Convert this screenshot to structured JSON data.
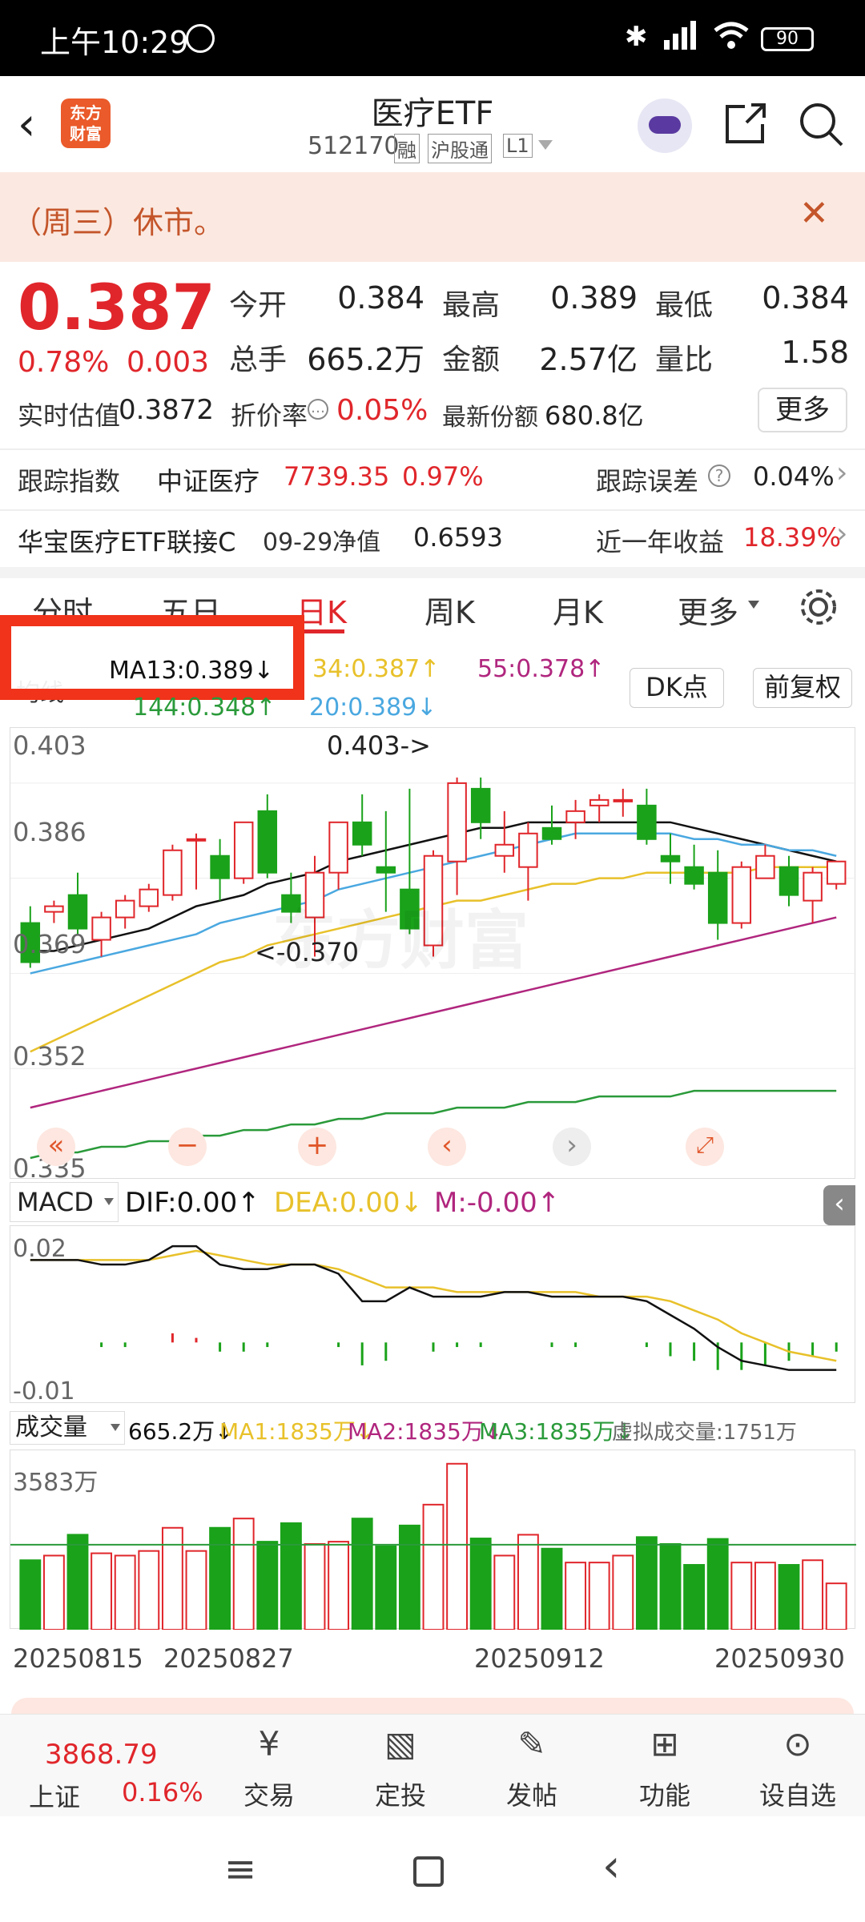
{
  "status": {
    "time": "上午10:29",
    "battery": "90"
  },
  "header": {
    "app_logo": "东方\n财富",
    "title": "医疗ETF",
    "code": "512170",
    "tag1": "融",
    "tag2": "沪股通",
    "tag3": "L1"
  },
  "notice": {
    "text": "（周三）休市。"
  },
  "quote": {
    "price": "0.387",
    "pct": "0.78%",
    "chg": "0.003",
    "open_label": "今开",
    "open": "0.384",
    "high_label": "最高",
    "high": "0.389",
    "low_label": "最低",
    "low": "0.384",
    "vol_label": "总手",
    "vol": "665.2万",
    "amt_label": "金额",
    "amt": "2.57亿",
    "ratio_label": "量比",
    "ratio": "1.58",
    "est_label": "实时估值",
    "est": "0.3872",
    "disc_label": "折价率",
    "disc": "0.05%",
    "share_label": "最新份额",
    "share": "680.8亿",
    "more": "更多"
  },
  "tracking": {
    "label": "跟踪指数",
    "name": "中证医疗",
    "value": "7739.35",
    "pct": "0.97%",
    "err_label": "跟踪误差",
    "err": "0.04%"
  },
  "fund": {
    "name": "华宝医疗ETF联接C",
    "date": "09-29净值",
    "nav": "0.6593",
    "ret_label": "近一年收益",
    "ret": "18.39%"
  },
  "tabs": [
    "分时",
    "五日",
    "日K",
    "周K",
    "月K",
    "更多"
  ],
  "ma_legend": {
    "type": "均线",
    "ma13": "MA13:0.389↓",
    "ma34": "34:0.387↑",
    "ma55": "55:0.378↑",
    "ma144": "144:0.348↑",
    "ma20": "20:0.389↓",
    "dk": "DK点",
    "fq": "前复权"
  },
  "kline_labels": {
    "y1": "0.403",
    "y2": "0.386",
    "y3": "0.369",
    "y4": "0.352",
    "y5": "0.335",
    "hi": "0.403->",
    "lo": "<-0.370",
    "watermark": "东方财富"
  },
  "macd": {
    "name": "MACD",
    "dif": "DIF:0.00↑",
    "dea": "DEA:0.00↓",
    "m": "M:-0.00↑",
    "ytop": "0.02",
    "ybot": "-0.01"
  },
  "volume": {
    "name": "成交量",
    "vol": "665.2万↓",
    "ma1": "MA1:1835万↓",
    "ma2": "MA2:1835万↓",
    "ma3": "MA3:1835万↓",
    "virtual": "虚拟成交量:1751万",
    "ytop": "3583万"
  },
  "xdates": [
    "20250815",
    "20250827",
    "20250912",
    "20250930"
  ],
  "bottom": {
    "index_val": "3868.79",
    "index_name": "上证",
    "index_pct": "0.16%",
    "items": [
      "交易",
      "定投",
      "发帖",
      "功能",
      "设自选"
    ]
  },
  "chart_data": {
    "type": "candlestick",
    "ylim": [
      0.335,
      0.41
    ],
    "candles": [
      {
        "o": 0.378,
        "h": 0.381,
        "l": 0.37,
        "c": 0.371
      },
      {
        "o": 0.38,
        "h": 0.382,
        "l": 0.378,
        "c": 0.381
      },
      {
        "o": 0.383,
        "h": 0.387,
        "l": 0.376,
        "c": 0.377
      },
      {
        "o": 0.375,
        "h": 0.38,
        "l": 0.372,
        "c": 0.379
      },
      {
        "o": 0.379,
        "h": 0.383,
        "l": 0.377,
        "c": 0.382
      },
      {
        "o": 0.381,
        "h": 0.385,
        "l": 0.38,
        "c": 0.384
      },
      {
        "o": 0.383,
        "h": 0.392,
        "l": 0.382,
        "c": 0.391
      },
      {
        "o": 0.393,
        "h": 0.394,
        "l": 0.384,
        "c": 0.393
      },
      {
        "o": 0.39,
        "h": 0.393,
        "l": 0.382,
        "c": 0.386
      },
      {
        "o": 0.386,
        "h": 0.396,
        "l": 0.385,
        "c": 0.396
      },
      {
        "o": 0.398,
        "h": 0.401,
        "l": 0.386,
        "c": 0.387
      },
      {
        "o": 0.383,
        "h": 0.387,
        "l": 0.378,
        "c": 0.38
      },
      {
        "o": 0.379,
        "h": 0.39,
        "l": 0.372,
        "c": 0.387
      },
      {
        "o": 0.387,
        "h": 0.396,
        "l": 0.384,
        "c": 0.396
      },
      {
        "o": 0.396,
        "h": 0.401,
        "l": 0.39,
        "c": 0.392
      },
      {
        "o": 0.388,
        "h": 0.398,
        "l": 0.38,
        "c": 0.387
      },
      {
        "o": 0.384,
        "h": 0.402,
        "l": 0.376,
        "c": 0.377
      },
      {
        "o": 0.374,
        "h": 0.391,
        "l": 0.372,
        "c": 0.39
      },
      {
        "o": 0.389,
        "h": 0.404,
        "l": 0.383,
        "c": 0.403
      },
      {
        "o": 0.402,
        "h": 0.404,
        "l": 0.393,
        "c": 0.396
      },
      {
        "o": 0.39,
        "h": 0.398,
        "l": 0.387,
        "c": 0.392
      },
      {
        "o": 0.388,
        "h": 0.396,
        "l": 0.382,
        "c": 0.394
      },
      {
        "o": 0.395,
        "h": 0.399,
        "l": 0.392,
        "c": 0.393
      },
      {
        "o": 0.396,
        "h": 0.4,
        "l": 0.393,
        "c": 0.398
      },
      {
        "o": 0.399,
        "h": 0.401,
        "l": 0.396,
        "c": 0.4
      },
      {
        "o": 0.4,
        "h": 0.402,
        "l": 0.397,
        "c": 0.4
      },
      {
        "o": 0.399,
        "h": 0.402,
        "l": 0.392,
        "c": 0.393
      },
      {
        "o": 0.39,
        "h": 0.394,
        "l": 0.385,
        "c": 0.389
      },
      {
        "o": 0.388,
        "h": 0.392,
        "l": 0.384,
        "c": 0.385
      },
      {
        "o": 0.387,
        "h": 0.391,
        "l": 0.375,
        "c": 0.378
      },
      {
        "o": 0.378,
        "h": 0.389,
        "l": 0.377,
        "c": 0.388
      },
      {
        "o": 0.386,
        "h": 0.392,
        "l": 0.386,
        "c": 0.39
      },
      {
        "o": 0.388,
        "h": 0.39,
        "l": 0.381,
        "c": 0.383
      },
      {
        "o": 0.382,
        "h": 0.388,
        "l": 0.378,
        "c": 0.387
      },
      {
        "o": 0.385,
        "h": 0.389,
        "l": 0.384,
        "c": 0.389
      }
    ],
    "ma_series": [
      {
        "color": "#111111",
        "values": [
          0.373,
          0.373,
          0.374,
          0.375,
          0.376,
          0.377,
          0.379,
          0.381,
          0.382,
          0.383,
          0.385,
          0.386,
          0.387,
          0.389,
          0.39,
          0.391,
          0.392,
          0.393,
          0.394,
          0.395,
          0.395,
          0.396,
          0.396,
          0.396,
          0.396,
          0.396,
          0.396,
          0.396,
          0.395,
          0.394,
          0.393,
          0.392,
          0.391,
          0.39,
          0.389
        ]
      },
      {
        "color": "#4aa8e0",
        "values": [
          0.369,
          0.37,
          0.371,
          0.372,
          0.373,
          0.374,
          0.375,
          0.376,
          0.378,
          0.379,
          0.38,
          0.381,
          0.382,
          0.384,
          0.385,
          0.386,
          0.387,
          0.388,
          0.389,
          0.39,
          0.391,
          0.392,
          0.393,
          0.394,
          0.394,
          0.394,
          0.394,
          0.394,
          0.393,
          0.393,
          0.392,
          0.392,
          0.391,
          0.391,
          0.39
        ]
      },
      {
        "color": "#e8c12a",
        "values": [
          0.355,
          0.357,
          0.359,
          0.361,
          0.363,
          0.365,
          0.367,
          0.369,
          0.371,
          0.372,
          0.374,
          0.375,
          0.376,
          0.377,
          0.378,
          0.379,
          0.38,
          0.381,
          0.382,
          0.382,
          0.383,
          0.384,
          0.385,
          0.385,
          0.386,
          0.386,
          0.387,
          0.387,
          0.387,
          0.387,
          0.387,
          0.388,
          0.388,
          0.388,
          0.388
        ]
      },
      {
        "color": "#b0267e",
        "values": [
          0.345,
          0.346,
          0.347,
          0.348,
          0.349,
          0.35,
          0.351,
          0.352,
          0.353,
          0.354,
          0.355,
          0.356,
          0.357,
          0.358,
          0.359,
          0.36,
          0.361,
          0.362,
          0.363,
          0.364,
          0.365,
          0.366,
          0.367,
          0.368,
          0.369,
          0.37,
          0.371,
          0.372,
          0.373,
          0.374,
          0.375,
          0.376,
          0.377,
          0.378,
          0.379
        ]
      },
      {
        "color": "#2a9a3a",
        "values": [
          0.336,
          0.337,
          0.337,
          0.338,
          0.338,
          0.339,
          0.339,
          0.34,
          0.34,
          0.341,
          0.341,
          0.342,
          0.342,
          0.343,
          0.343,
          0.344,
          0.344,
          0.344,
          0.345,
          0.345,
          0.345,
          0.346,
          0.346,
          0.346,
          0.347,
          0.347,
          0.347,
          0.347,
          0.348,
          0.348,
          0.348,
          0.348,
          0.348,
          0.348,
          0.348
        ]
      }
    ],
    "volumes": [
      1500,
      1600,
      2050,
      1650,
      1600,
      1700,
      2200,
      1700,
      2200,
      2400,
      1900,
      2300,
      1850,
      1900,
      2400,
      1800,
      2250,
      2700,
      3583,
      1970,
      1600,
      2050,
      1750,
      1450,
      1450,
      1600,
      2000,
      1850,
      1400,
      1960,
      1450,
      1450,
      1400,
      1500,
      1000
    ],
    "vol_ma": 1835,
    "macd_dif": [
      0.018,
      0.018,
      0.018,
      0.017,
      0.017,
      0.018,
      0.021,
      0.021,
      0.017,
      0.016,
      0.016,
      0.017,
      0.017,
      0.015,
      0.009,
      0.009,
      0.012,
      0.01,
      0.01,
      0.01,
      0.011,
      0.011,
      0.01,
      0.01,
      0.01,
      0.01,
      0.009,
      0.006,
      0.003,
      -0.001,
      -0.004,
      -0.005,
      -0.006,
      -0.006,
      -0.006
    ],
    "macd_dea": [
      0.018,
      0.018,
      0.018,
      0.018,
      0.018,
      0.018,
      0.019,
      0.02,
      0.019,
      0.018,
      0.017,
      0.017,
      0.017,
      0.016,
      0.014,
      0.012,
      0.012,
      0.012,
      0.011,
      0.011,
      0.011,
      0.011,
      0.011,
      0.011,
      0.01,
      0.01,
      0.01,
      0.009,
      0.007,
      0.005,
      0.002,
      0.0,
      -0.002,
      -0.003,
      -0.004
    ],
    "macd_m": [
      0.0,
      0.0,
      0.0,
      -0.001,
      -0.001,
      0.0,
      0.002,
      0.001,
      -0.002,
      -0.002,
      -0.001,
      0.0,
      0.0,
      -0.001,
      -0.005,
      -0.004,
      0.0,
      -0.002,
      -0.001,
      -0.001,
      0.0,
      0.0,
      -0.001,
      -0.001,
      0.0,
      0.0,
      -0.001,
      -0.003,
      -0.004,
      -0.006,
      -0.006,
      -0.005,
      -0.004,
      -0.003,
      -0.002
    ]
  }
}
